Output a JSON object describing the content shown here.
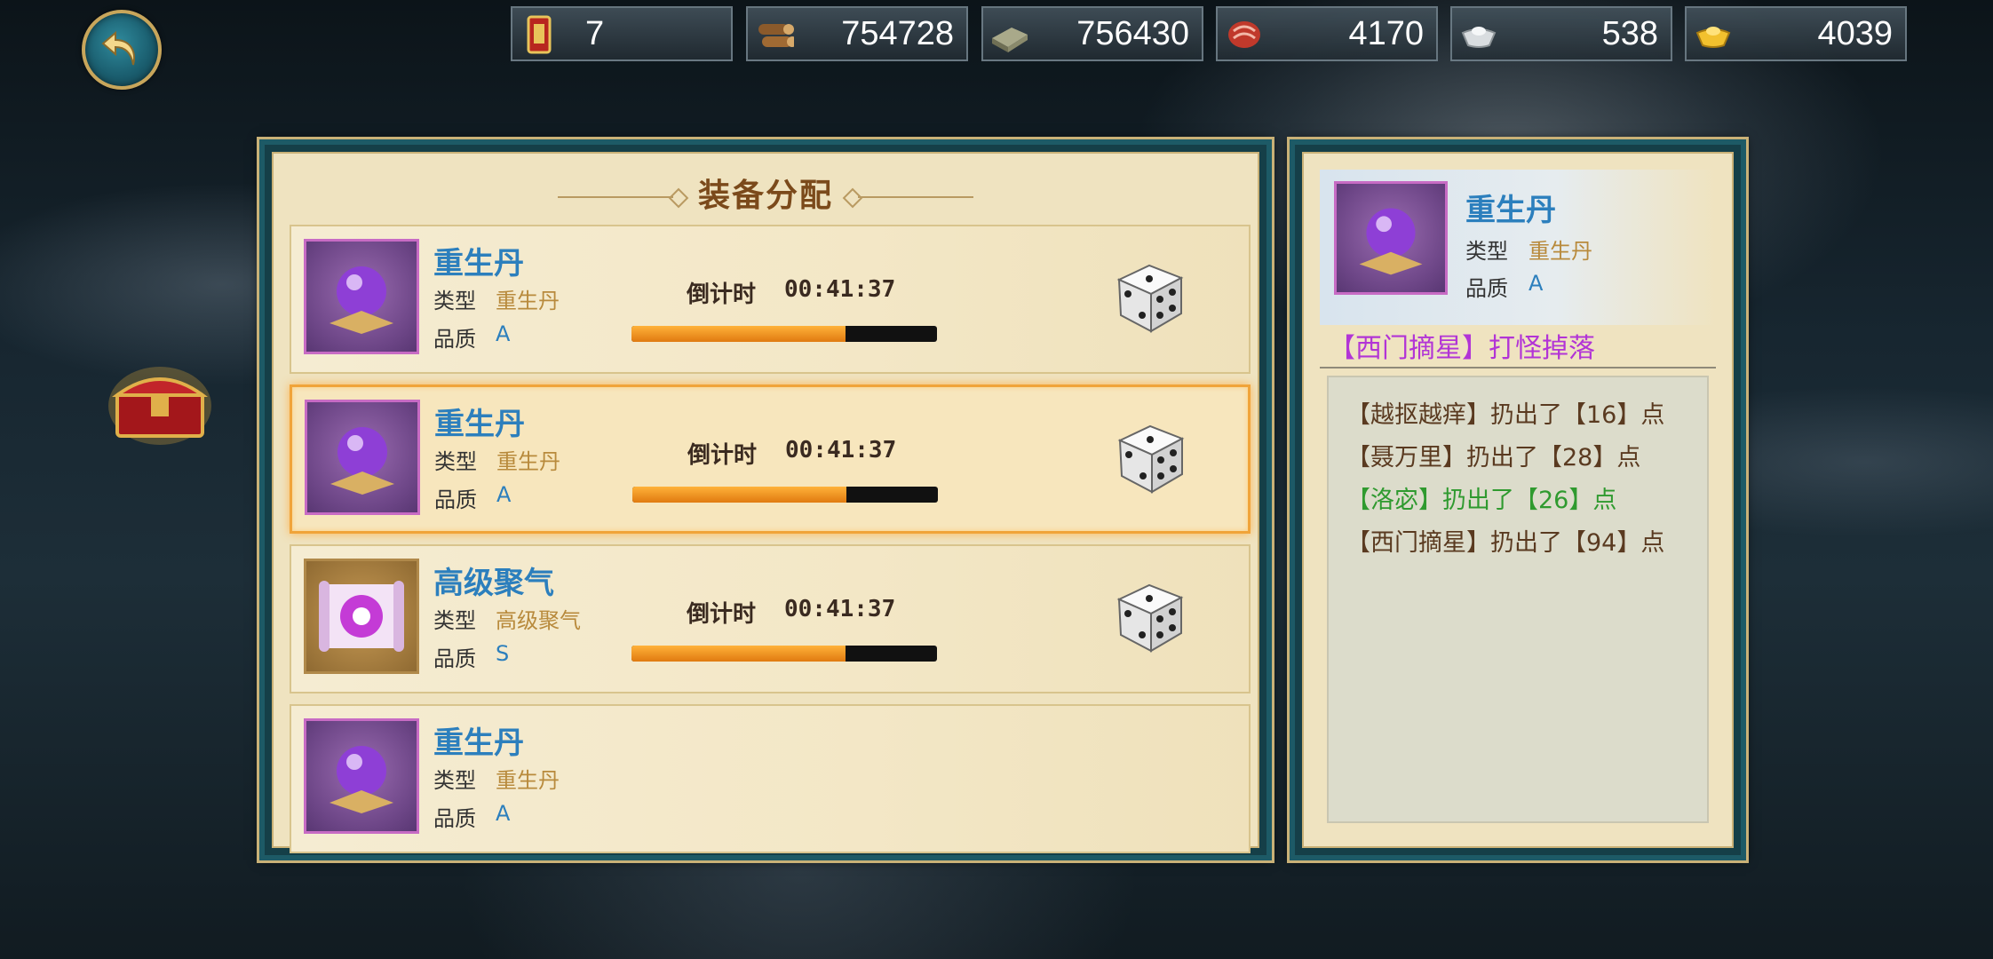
{
  "resources": [
    {
      "icon": "token-icon",
      "value": "7"
    },
    {
      "icon": "wood-icon",
      "value": "754728"
    },
    {
      "icon": "stone-icon",
      "value": "756430"
    },
    {
      "icon": "meat-icon",
      "value": "4170"
    },
    {
      "icon": "silver-icon",
      "value": "538"
    },
    {
      "icon": "gold-icon",
      "value": "4039"
    }
  ],
  "panel": {
    "title": "装备分配",
    "type_label": "类型",
    "quality_label": "品质",
    "countdown_label": "倒计时",
    "items": [
      {
        "name": "重生丹",
        "type": "重生丹",
        "quality": "A",
        "countdown": "00:41:37",
        "progress": 0.7,
        "icon": "purple-orb-icon"
      },
      {
        "name": "重生丹",
        "type": "重生丹",
        "quality": "A",
        "countdown": "00:41:37",
        "progress": 0.7,
        "icon": "purple-orb-icon",
        "selected": true
      },
      {
        "name": "高级聚气",
        "type": "高级聚气",
        "quality": "S",
        "countdown": "00:41:37",
        "progress": 0.7,
        "icon": "scroll-icon"
      },
      {
        "name": "重生丹",
        "type": "重生丹",
        "quality": "A",
        "icon": "purple-orb-icon"
      }
    ]
  },
  "detail": {
    "name": "重生丹",
    "type_label": "类型",
    "type": "重生丹",
    "quality_label": "品质",
    "quality": "A",
    "drop_source": "【西门摘星】打怪掉落",
    "log": [
      {
        "text": "【越抠越痒】扔出了【16】点",
        "color": "#5a3a20"
      },
      {
        "text": "【聂万里】扔出了【28】点",
        "color": "#5a3a20"
      },
      {
        "text": "【洛宓】扔出了【26】点",
        "color": "#2f9a2f"
      },
      {
        "text": "【西门摘星】扔出了【94】点",
        "color": "#5a3a20"
      }
    ]
  }
}
